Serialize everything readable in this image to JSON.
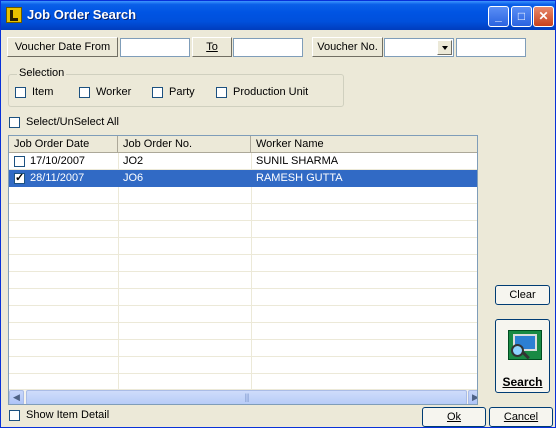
{
  "window": {
    "title": "Job Order Search"
  },
  "titlebar": {
    "minimize_glyph": "_",
    "maximize_glyph": "□",
    "close_glyph": "✕"
  },
  "filters": {
    "voucher_date_from_label": "Voucher Date From",
    "to_label": "To",
    "date_from_value": "",
    "date_to_value": "",
    "voucher_no_label": "Voucher No.",
    "voucher_no_combo_value": "",
    "voucher_no_value": ""
  },
  "selection": {
    "label": "Selection",
    "options": [
      "Item",
      "Worker",
      "Party",
      "Production Unit"
    ]
  },
  "select_all": {
    "label": "Select/UnSelect All"
  },
  "grid": {
    "columns": [
      "Job Order Date",
      "Job Order No.",
      "Worker Name"
    ],
    "rows": [
      {
        "date": "17/10/2007",
        "job_no": "JO2",
        "worker": "SUNIL SHARMA",
        "checked": false,
        "selected": false
      },
      {
        "date": "28/11/2007",
        "job_no": "JO6",
        "worker": "RAMESH GUTTA",
        "checked": true,
        "selected": true
      }
    ],
    "scroll_left_glyph": "◀",
    "scroll_right_glyph": "▶",
    "thumb_grip": "|||"
  },
  "actions": {
    "clear_label": "Clear",
    "search_label": "Search",
    "ok_label": "Ok",
    "cancel_label": "Cancel",
    "show_item_detail_label": "Show Item Detail"
  },
  "colors": {
    "titlebar": "#0054e3",
    "selection_row": "#316ac5",
    "face": "#ece9d8"
  },
  "icons": {
    "app": "app-icon",
    "search": "search-computer-icon"
  }
}
